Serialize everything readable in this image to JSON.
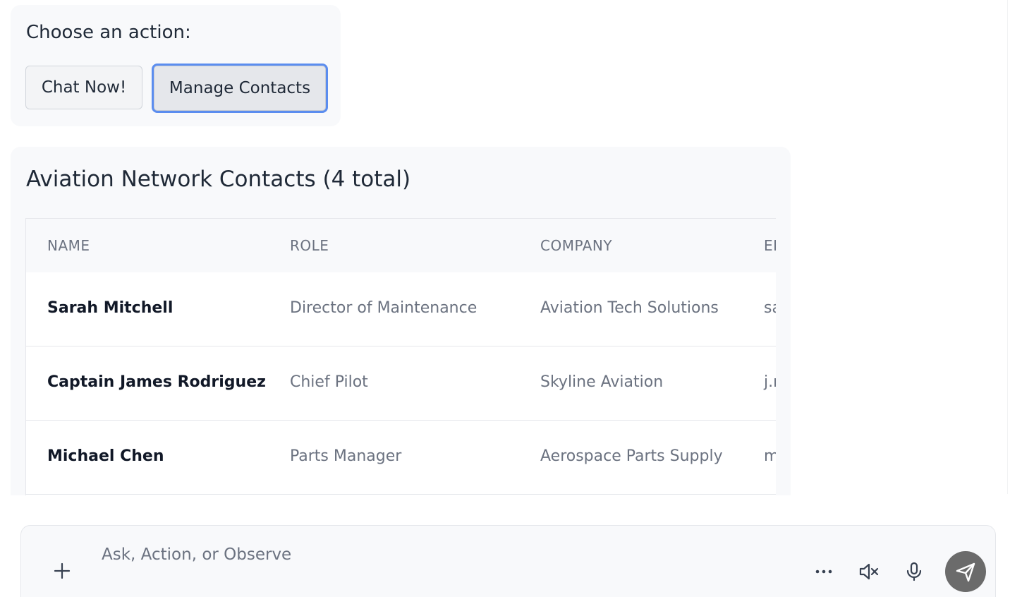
{
  "actions": {
    "title": "Choose an action:",
    "chat_label": "Chat Now!",
    "manage_label": "Manage Contacts"
  },
  "contacts": {
    "title": "Aviation Network Contacts (4 total)",
    "columns": [
      "NAME",
      "ROLE",
      "COMPANY",
      "EMAIL"
    ],
    "rows": [
      {
        "name": "Sarah Mitchell",
        "role": "Director of Maintenance",
        "company": "Aviation Tech Solutions",
        "email": "sa"
      },
      {
        "name": "Captain James Rodriguez",
        "role": "Chief Pilot",
        "company": "Skyline Aviation",
        "email": "j.r"
      },
      {
        "name": "Michael Chen",
        "role": "Parts Manager",
        "company": "Aerospace Parts Supply",
        "email": "m"
      }
    ]
  },
  "input_bar": {
    "placeholder": "Ask, Action, or Observe",
    "icons": [
      "plus-icon",
      "more-icon",
      "mute-icon",
      "microphone-icon",
      "send-icon"
    ]
  },
  "colors": {
    "focus_ring": "#5b8def",
    "send_button": "#6b6b6b"
  }
}
